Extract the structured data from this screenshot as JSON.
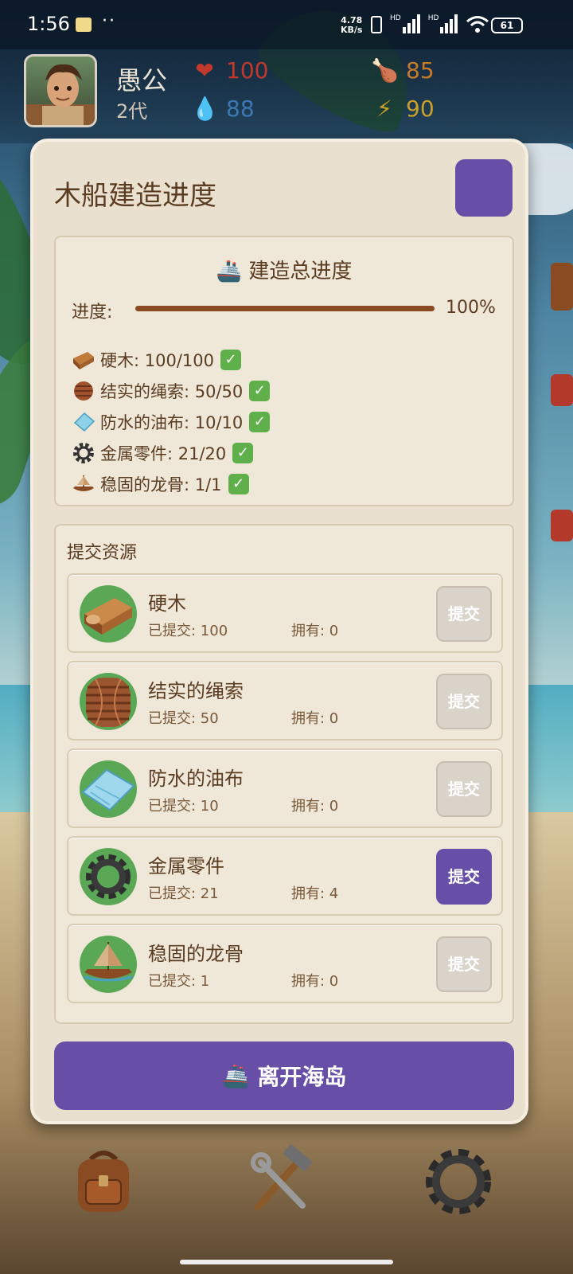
{
  "status_bar": {
    "time": "1:56",
    "net_speed_value": "4.78",
    "net_speed_unit": "KB/s",
    "battery": "61",
    "signal_labels": [
      "HD",
      "HD"
    ]
  },
  "player": {
    "name": "愚公",
    "generation": "2代",
    "health": "100",
    "water": "88",
    "food": "85",
    "energy": "90"
  },
  "colors": {
    "accent": "#674ea7",
    "health": "#c0392b",
    "water": "#3c78b4",
    "food": "#c87a2a",
    "energy": "#c8a02a",
    "progress": "#8b4b22",
    "check": "#5fb04a"
  },
  "modal": {
    "title": "木船建造进度",
    "overall": {
      "title": "建造总进度",
      "progress_label": "进度:",
      "progress_value": "100%",
      "progress_fraction": 1.0
    },
    "requirements": [
      {
        "icon": "hardwood-icon",
        "text": "硬木: 100/100"
      },
      {
        "icon": "rope-icon",
        "text": "结实的绳索: 50/50"
      },
      {
        "icon": "tarp-icon",
        "text": "防水的油布: 10/10"
      },
      {
        "icon": "gear-icon",
        "text": "金属零件: 21/20"
      },
      {
        "icon": "keel-icon",
        "text": "稳固的龙骨: 1/1"
      }
    ],
    "submit_section": {
      "title": "提交资源",
      "button_label": "提交",
      "resources": [
        {
          "name": "硬木",
          "submitted": "已提交: 100",
          "owned": "拥有: 0",
          "active": false
        },
        {
          "name": "结实的绳索",
          "submitted": "已提交: 50",
          "owned": "拥有: 0",
          "active": false
        },
        {
          "name": "防水的油布",
          "submitted": "已提交: 10",
          "owned": "拥有: 0",
          "active": false
        },
        {
          "name": "金属零件",
          "submitted": "已提交: 21",
          "owned": "拥有: 4",
          "active": true
        },
        {
          "name": "稳固的龙骨",
          "submitted": "已提交: 1",
          "owned": "拥有: 0",
          "active": false
        }
      ]
    },
    "leave_button": "离开海岛"
  },
  "toolbar": {
    "items": [
      "backpack-icon",
      "tools-icon",
      "settings-icon"
    ]
  }
}
